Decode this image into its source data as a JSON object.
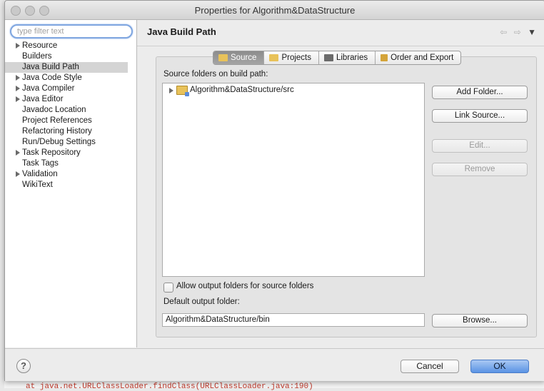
{
  "window": {
    "title": "Properties for Algorithm&DataStructure"
  },
  "sidebar": {
    "filter_placeholder": "type filter text",
    "items": [
      {
        "label": "Resource",
        "expandable": true
      },
      {
        "label": "Builders",
        "expandable": false
      },
      {
        "label": "Java Build Path",
        "expandable": false,
        "selected": true
      },
      {
        "label": "Java Code Style",
        "expandable": true
      },
      {
        "label": "Java Compiler",
        "expandable": true
      },
      {
        "label": "Java Editor",
        "expandable": true
      },
      {
        "label": "Javadoc Location",
        "expandable": false
      },
      {
        "label": "Project References",
        "expandable": false
      },
      {
        "label": "Refactoring History",
        "expandable": false
      },
      {
        "label": "Run/Debug Settings",
        "expandable": false
      },
      {
        "label": "Task Repository",
        "expandable": true
      },
      {
        "label": "Task Tags",
        "expandable": false
      },
      {
        "label": "Validation",
        "expandable": true
      },
      {
        "label": "WikiText",
        "expandable": false
      }
    ]
  },
  "main": {
    "title": "Java Build Path",
    "nav": {
      "back_icon": "⇦",
      "forward_icon": "⇨",
      "menu_icon": "▼"
    },
    "tabs": [
      {
        "label": "Source",
        "active": true,
        "icon_color": "#e8c25a"
      },
      {
        "label": "Projects",
        "active": false,
        "icon_color": "#e8c25a"
      },
      {
        "label": "Libraries",
        "active": false,
        "icon_color": "#6b6b6b"
      },
      {
        "label": "Order and Export",
        "active": false,
        "icon_color": "#d4a43a"
      }
    ],
    "source_label": "Source folders on build path:",
    "source_folders": [
      "Algorithm&DataStructure/src"
    ],
    "buttons": {
      "add_folder": "Add Folder...",
      "link_source": "Link Source...",
      "edit": "Edit...",
      "remove": "Remove",
      "browse": "Browse..."
    },
    "allow_output_label": "Allow output folders for source folders",
    "default_output_label": "Default output folder:",
    "default_output_value": "Algorithm&DataStructure/bin"
  },
  "footer": {
    "help": "?",
    "cancel": "Cancel",
    "ok": "OK"
  },
  "background": {
    "console_line": "at java.net.URLClassLoader.findClass(URLClassLoader.java:190)"
  }
}
